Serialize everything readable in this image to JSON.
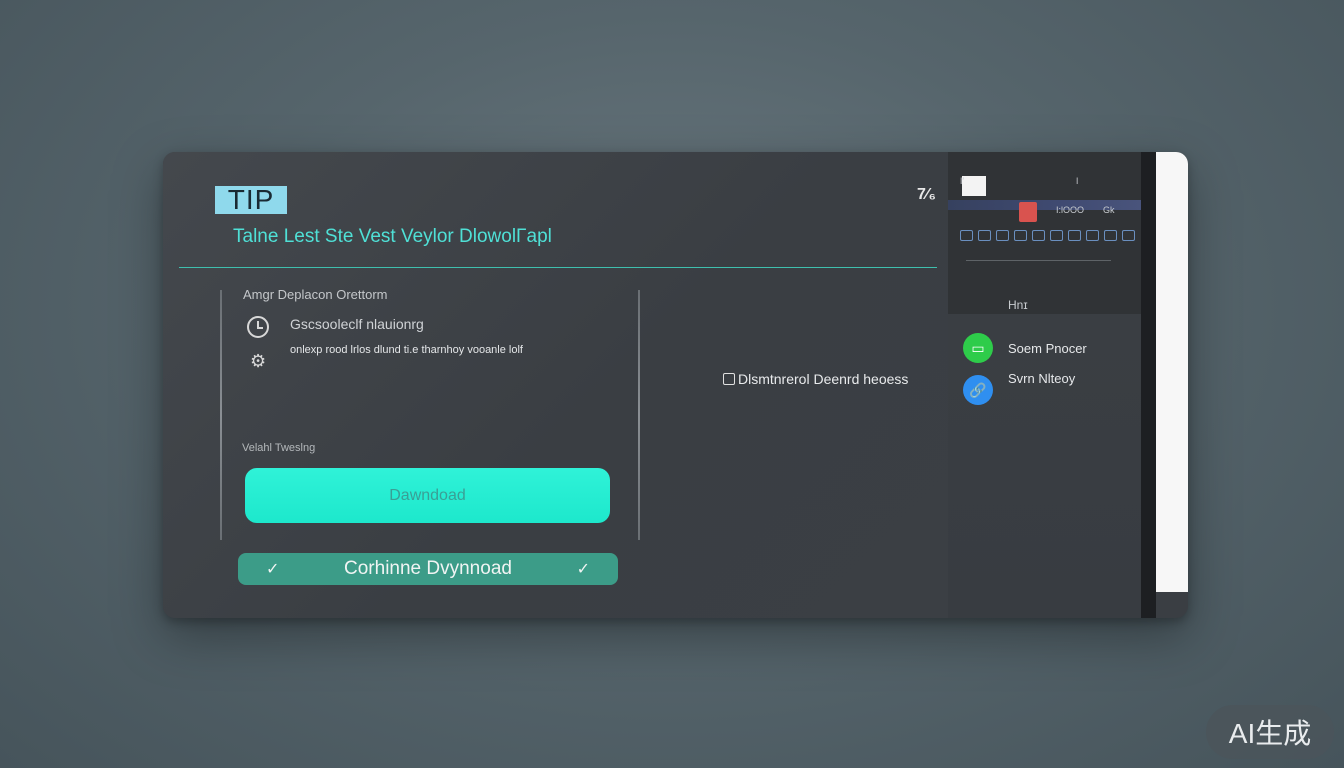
{
  "header": {
    "badge": "TIP",
    "corner_number": "7⁄₆",
    "title": "Talne Lest Ste  Vest Veylor DlowolΓapl"
  },
  "main": {
    "section_label": "Amgr  Deplacon Orettorm",
    "items": [
      {
        "icon": "clock-icon",
        "text": "Gscsooleclf nlauionrg"
      },
      {
        "icon": "gear-icon",
        "text": "onlexp  rood lrlos  dlund  ti.e  tharnhoy vooanle lolf"
      }
    ],
    "small_label": "Velahl Tweslng",
    "primary_button": "Dawndoad",
    "confirm_button": "Corhinne Dvynnoad",
    "checkbox_label": "Dlsmtnrerol Deenrd heoess"
  },
  "side_panel": {
    "tiny_left": "ǀ′",
    "tiny_right": "ǀ",
    "tiny_a": "I:lOOO",
    "tiny_b": "Gk",
    "heading": "Hnɪ",
    "items": [
      {
        "icon": "document-icon",
        "label": "Soem Pnocer",
        "color": "#2ecc4a"
      },
      {
        "icon": "link-icon",
        "label": "Svrn Nlteoy",
        "color": "#2f8ff0"
      }
    ]
  },
  "watermark": "AI生成",
  "colors": {
    "accent": "#1de8cc",
    "title_text": "#4fe0d6",
    "confirm_button": "#3c9c88",
    "badge_bg": "#8fd9ec"
  }
}
